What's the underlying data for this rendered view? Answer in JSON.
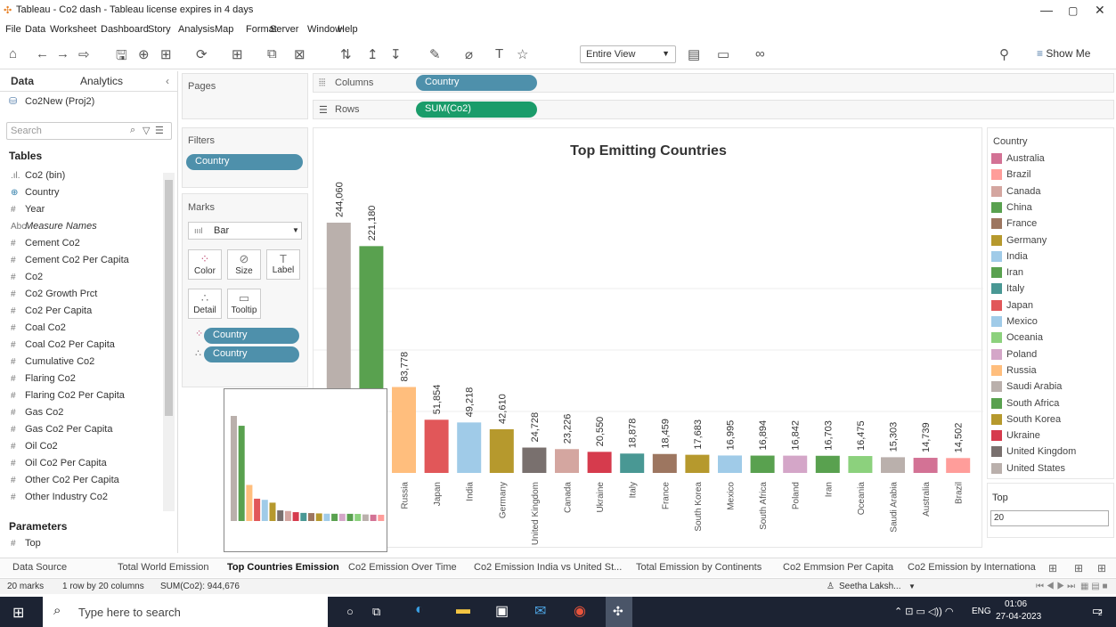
{
  "window": {
    "title": "Tableau - Co2 dash - Tableau license expires in 4 days"
  },
  "menu": [
    "File",
    "Data",
    "Worksheet",
    "Dashboard",
    "Story",
    "Analysis",
    "Map",
    "Format",
    "Server",
    "Window",
    "Help"
  ],
  "toolbar": {
    "fit": "Entire View",
    "show_me": "Show Me"
  },
  "data_pane": {
    "tab_data": "Data",
    "tab_analytics": "Analytics",
    "datasource": "Co2New (Proj2)",
    "search_placeholder": "Search",
    "tables_title": "Tables",
    "fields": [
      {
        "icon": ".ıl.",
        "name": "Co2 (bin)"
      },
      {
        "icon": "⊕",
        "name": "Country"
      },
      {
        "icon": "#",
        "name": "Year"
      },
      {
        "icon": "Abc",
        "name": "Measure Names"
      },
      {
        "icon": "#",
        "name": "Cement Co2"
      },
      {
        "icon": "#",
        "name": "Cement Co2 Per Capita"
      },
      {
        "icon": "#",
        "name": "Co2"
      },
      {
        "icon": "#",
        "name": "Co2 Growth Prct"
      },
      {
        "icon": "#",
        "name": "Co2 Per Capita"
      },
      {
        "icon": "#",
        "name": "Coal Co2"
      },
      {
        "icon": "#",
        "name": "Coal Co2 Per Capita"
      },
      {
        "icon": "#",
        "name": "Cumulative Co2"
      },
      {
        "icon": "#",
        "name": "Flaring Co2"
      },
      {
        "icon": "#",
        "name": "Flaring Co2 Per Capita"
      },
      {
        "icon": "#",
        "name": "Gas Co2"
      },
      {
        "icon": "#",
        "name": "Gas Co2 Per Capita"
      },
      {
        "icon": "#",
        "name": "Oil Co2"
      },
      {
        "icon": "#",
        "name": "Oil Co2 Per Capita"
      },
      {
        "icon": "#",
        "name": "Other Co2 Per Capita"
      },
      {
        "icon": "#",
        "name": "Other Industry Co2"
      }
    ],
    "parameters_title": "Parameters",
    "parameter": {
      "icon": "#",
      "name": "Top"
    }
  },
  "shelves": {
    "pages": "Pages",
    "columns_label": "Columns",
    "columns_pill": "Country",
    "rows_label": "Rows",
    "rows_pill": "SUM(Co2)",
    "filters": "Filters",
    "filter_pill": "Country",
    "marks": "Marks",
    "mark_type": "Bar",
    "mark_buttons": [
      "Color",
      "Size",
      "Label",
      "Detail",
      "Tooltip"
    ],
    "mark_pills": [
      "Country",
      "Country"
    ]
  },
  "chart_data": {
    "type": "bar",
    "title": "Top Emitting Countries",
    "xlabel": "",
    "ylabel": "",
    "categories": [
      "United States",
      "China",
      "Russia",
      "Japan",
      "India",
      "Germany",
      "United Kingdom",
      "Canada",
      "Ukraine",
      "Italy",
      "France",
      "South Korea",
      "Mexico",
      "South Africa",
      "Poland",
      "Iran",
      "Oceania",
      "Saudi Arabia",
      "Australia",
      "Brazil"
    ],
    "values": [
      244060,
      221180,
      83778,
      51854,
      49218,
      42610,
      24728,
      23226,
      20550,
      18878,
      18459,
      17683,
      16995,
      16894,
      16842,
      16703,
      16475,
      15303,
      14739,
      14502
    ],
    "labels": [
      "244,060",
      "221,180",
      "83,778",
      "51,854",
      "49,218",
      "42,610",
      "24,728",
      "23,226",
      "20,550",
      "18,878",
      "18,459",
      "17,683",
      "16,995",
      "16,894",
      "16,842",
      "16,703",
      "16,475",
      "15,303",
      "14,739",
      "14,502"
    ],
    "colors": [
      "#bab0ac",
      "#59a14f",
      "#ffbe7d",
      "#e15759",
      "#a0cbe8",
      "#b6992d",
      "#79706e",
      "#d4a6a0",
      "#d63b4d",
      "#499894",
      "#9d7660",
      "#b6992d",
      "#a0cbe8",
      "#59a14f",
      "#d4a6c8",
      "#59a14f",
      "#8cd17d",
      "#bab0ac",
      "#d37295",
      "#ff9d9a"
    ],
    "ylim": [
      0,
      260000
    ],
    "grid": true
  },
  "legend": {
    "title": "Country",
    "items": [
      {
        "name": "Australia",
        "color": "#d37295"
      },
      {
        "name": "Brazil",
        "color": "#ff9d9a"
      },
      {
        "name": "Canada",
        "color": "#d4a6a0"
      },
      {
        "name": "China",
        "color": "#59a14f"
      },
      {
        "name": "France",
        "color": "#9d7660"
      },
      {
        "name": "Germany",
        "color": "#b6992d"
      },
      {
        "name": "India",
        "color": "#a0cbe8"
      },
      {
        "name": "Iran",
        "color": "#59a14f"
      },
      {
        "name": "Italy",
        "color": "#499894"
      },
      {
        "name": "Japan",
        "color": "#e15759"
      },
      {
        "name": "Mexico",
        "color": "#a0cbe8"
      },
      {
        "name": "Oceania",
        "color": "#8cd17d"
      },
      {
        "name": "Poland",
        "color": "#d4a6c8"
      },
      {
        "name": "Russia",
        "color": "#ffbe7d"
      },
      {
        "name": "Saudi Arabia",
        "color": "#bab0ac"
      },
      {
        "name": "South Africa",
        "color": "#59a14f"
      },
      {
        "name": "South Korea",
        "color": "#b6992d"
      },
      {
        "name": "Ukraine",
        "color": "#d63b4d"
      },
      {
        "name": "United Kingdom",
        "color": "#79706e"
      },
      {
        "name": "United States",
        "color": "#bab0ac"
      }
    ]
  },
  "top_param": {
    "title": "Top",
    "value": "20"
  },
  "sheet_tabs": [
    "Data Source",
    "Total World Emission",
    "Top Countries Emission",
    "Co2 Emission Over Time",
    "Co2 Emission India vs United St...",
    "Total Emission by Continents",
    "Co2 Emmsion Per Capita",
    "Co2 Emission by Internationa"
  ],
  "active_tab": "Top Countries Emission",
  "status": {
    "marks": "20 marks",
    "layout": "1 row by 20 columns",
    "sum": "SUM(Co2): 944,676",
    "user": "Seetha Laksh..."
  },
  "taskbar": {
    "search_placeholder": "Type here to search",
    "lang": "ENG",
    "time": "01:06",
    "date": "27-04-2023",
    "notif": "2"
  }
}
